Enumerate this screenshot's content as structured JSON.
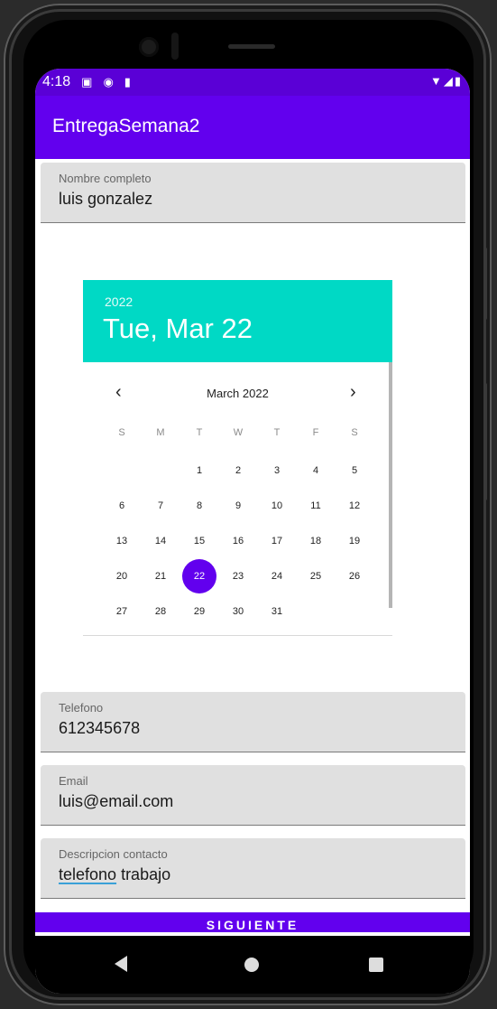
{
  "status_bar": {
    "time": "4:18",
    "icons": [
      "sim-card-icon",
      "sync-icon",
      "sd-card-icon"
    ],
    "right_icons": [
      "wifi-icon",
      "signal-icon",
      "battery-icon"
    ]
  },
  "app_bar": {
    "title": "EntregaSemana2"
  },
  "fields": {
    "nombre": {
      "label": "Nombre completo",
      "value": "luis gonzalez"
    },
    "telefono": {
      "label": "Telefono",
      "value": "612345678"
    },
    "email": {
      "label": "Email",
      "value": "luis@email.com"
    },
    "descripcion": {
      "label": "Descripcion contacto",
      "value_word1": "telefono",
      "value_word2": " trabajo"
    }
  },
  "date_picker": {
    "year": "2022",
    "selected_date": "Tue, Mar 22",
    "month_label": "March 2022",
    "prev_icon": "‹",
    "next_icon": "›",
    "weekdays": [
      "S",
      "M",
      "T",
      "W",
      "T",
      "F",
      "S"
    ],
    "first_weekday_index": 2,
    "days_in_month": 31,
    "selected_day": 22
  },
  "siguiente_button": {
    "label": "SIGUIENTE"
  },
  "colors": {
    "primary": "#6200ee",
    "status_bar": "#5a00d6",
    "picker_header": "#00d9c5",
    "field_bg": "#e0e0e0"
  }
}
